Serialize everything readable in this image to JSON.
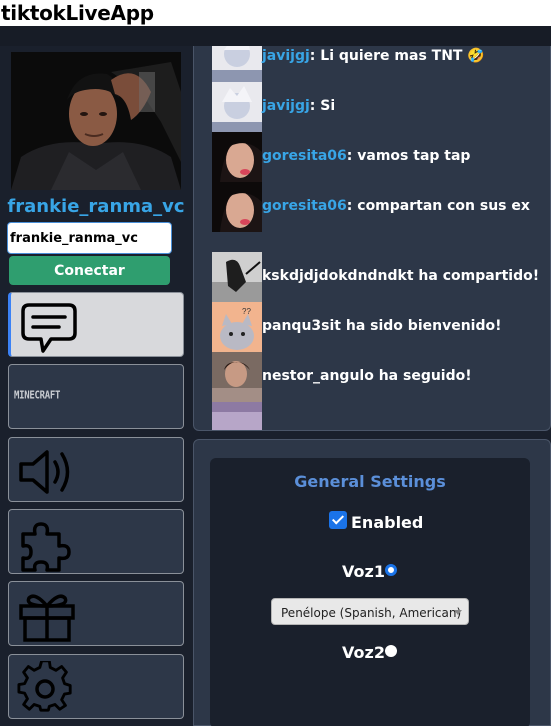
{
  "app": {
    "title": "tiktokLiveApp"
  },
  "sidebar": {
    "username": "frankie_ranma_vc",
    "input_value": "frankie_ranma_vc",
    "connect_label": "Conectar",
    "nav": [
      {
        "name": "chat",
        "icon": "chat-bubble-icon",
        "active": true
      },
      {
        "name": "minecraft",
        "icon": "minecraft-logo",
        "label": "MINECRAFT"
      },
      {
        "name": "sound",
        "icon": "speaker-icon"
      },
      {
        "name": "plugins",
        "icon": "puzzle-icon"
      },
      {
        "name": "gifts",
        "icon": "gift-icon"
      },
      {
        "name": "settings",
        "icon": "gear-icon"
      }
    ]
  },
  "chat": {
    "messages": [
      {
        "user": "javijgj",
        "text": ": Li quiere mas TNT 🤣"
      },
      {
        "user": "javijgj",
        "text": ": Si"
      },
      {
        "user": "goresita06",
        "text": ": vamos tap tap"
      },
      {
        "user": "goresita06",
        "text": ": compartan con sus ex"
      },
      {
        "user": "",
        "text": "kskdjdjdokdndndkt ha compartido!"
      },
      {
        "user": "",
        "text": "panqu3sit ha sido bienvenido!"
      },
      {
        "user": "",
        "text": "nestor_angulo ha seguido!"
      }
    ]
  },
  "settings": {
    "title": "General Settings",
    "enabled_label": "Enabled",
    "enabled": true,
    "voz1_label": "Voz1",
    "voz2_label": "Voz2",
    "selected_voice": "Penélope (Spanish, American)"
  },
  "colors": {
    "accent": "#38a5e6",
    "connect_button": "#2f9e6f",
    "panel": "#2d3748",
    "background": "#1a202c",
    "settings_title": "#5b8fd9"
  }
}
